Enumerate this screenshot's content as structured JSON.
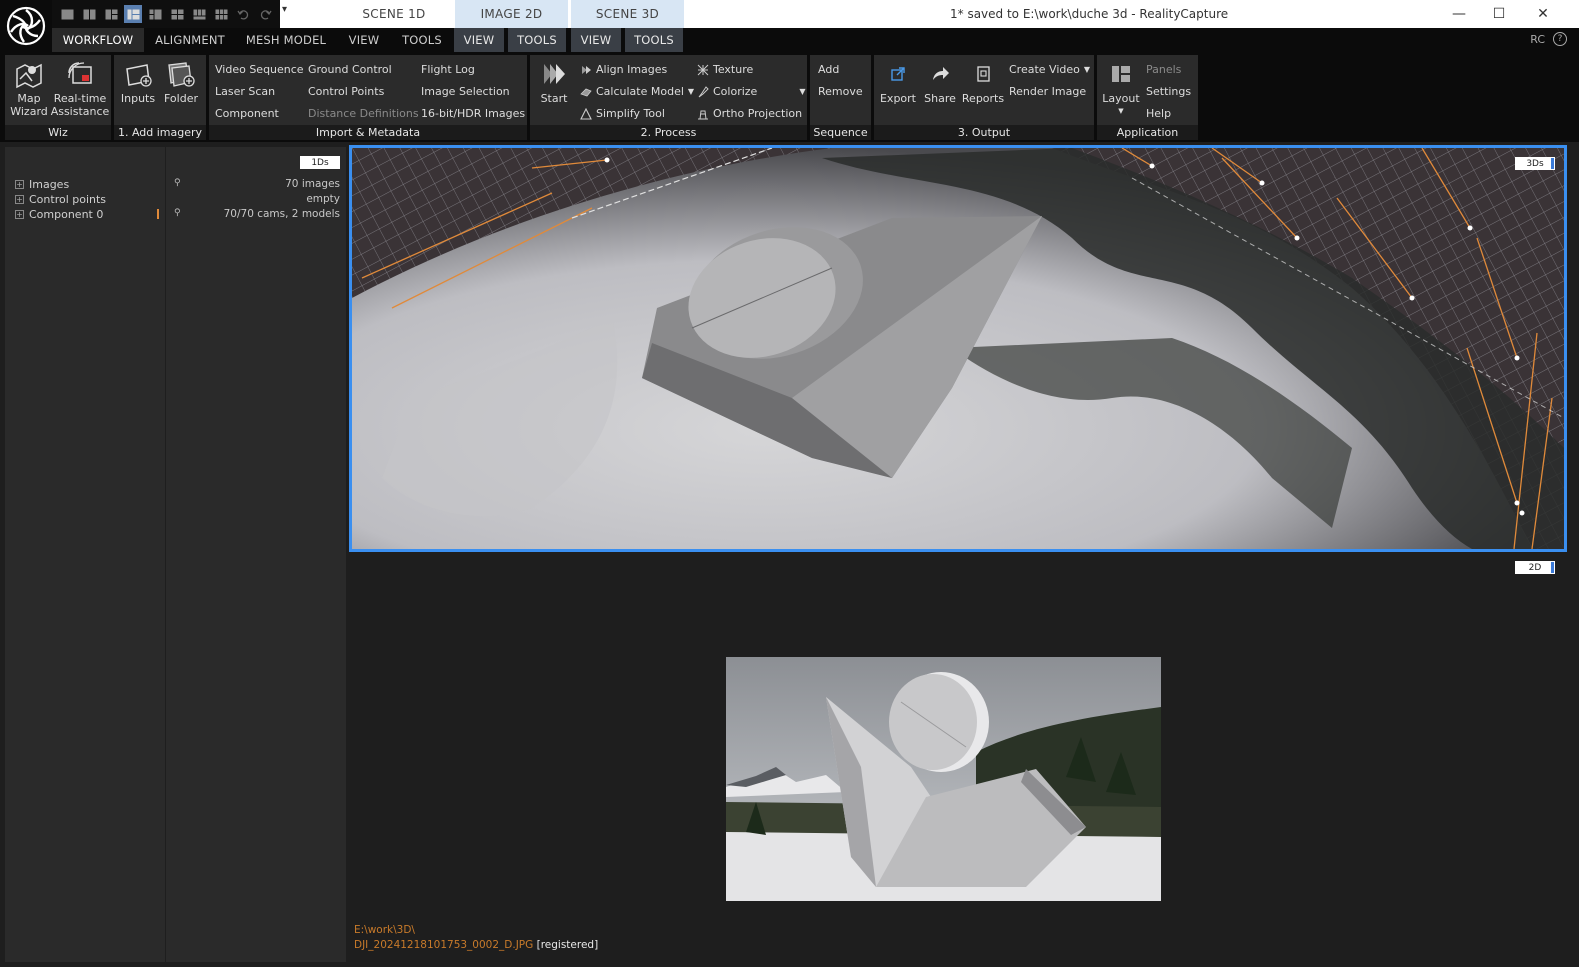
{
  "title_bar": {
    "scene_tabs": [
      "SCENE 1D",
      "IMAGE 2D",
      "SCENE 3D"
    ],
    "window_title": "1* saved to E:\\work\\duche 3d - RealityCapture",
    "minimize": "—",
    "maximize": "☐",
    "close": "✕",
    "quick_menu": "▾"
  },
  "menu": {
    "items": [
      "WORKFLOW",
      "ALIGNMENT",
      "MESH MODEL",
      "VIEW",
      "TOOLS",
      "VIEW",
      "TOOLS",
      "VIEW",
      "TOOLS"
    ],
    "active": "WORKFLOW",
    "right_label": "RC",
    "help": "?"
  },
  "ribbon": {
    "wiz": {
      "label": "Wiz",
      "map_wizard": [
        "Map",
        "Wizard"
      ],
      "realtime": [
        "Real-time",
        "Assistance"
      ]
    },
    "add_imagery": {
      "label": "1. Add imagery",
      "inputs": "Inputs",
      "folder": "Folder"
    },
    "import": {
      "label": "Import & Metadata",
      "video_sequence": "Video Sequence",
      "laser_scan": "Laser Scan",
      "component": "Component",
      "ground_control": "Ground Control",
      "control_points": "Control Points",
      "distance_definitions": "Distance Definitions",
      "flight_log": "Flight Log",
      "image_selection": "Image Selection",
      "hdr_images": "16-bit/HDR Images"
    },
    "process": {
      "label": "2. Process",
      "start": "Start",
      "align_images": "Align Images",
      "calculate_model": "Calculate Model",
      "simplify_tool": "Simplify Tool",
      "texture": "Texture",
      "colorize": "Colorize",
      "ortho_projection": "Ortho Projection"
    },
    "sequence": {
      "label": "Sequence",
      "add": "Add",
      "remove": "Remove"
    },
    "output": {
      "label": "3. Output",
      "export": "Export",
      "share": "Share",
      "reports": "Reports",
      "create_video": "Create Video",
      "render_image": "Render Image"
    },
    "application": {
      "label": "Application",
      "layout": "Layout",
      "panels": "Panels",
      "settings": "Settings",
      "help": "Help"
    }
  },
  "panel_1ds": {
    "badge": "1Ds",
    "rows": [
      {
        "name": "Images",
        "value": "70 images"
      },
      {
        "name": "Control points",
        "value": "empty"
      },
      {
        "name": "Component 0",
        "value": "70/70 cams, 2 models"
      }
    ]
  },
  "view_3d": {
    "badge": "3Ds"
  },
  "view_2d": {
    "badge": "2D",
    "path": "E:\\work\\3D\\",
    "filename": "DJI_20241218101753_0002_D.JPG",
    "status": "[registered]"
  },
  "colors": {
    "accent": "#3a8ff0",
    "ribbon_bg": "#2b2b2b",
    "highlight_tab": "#d8e6f4",
    "file_text": "#c87a2a"
  }
}
